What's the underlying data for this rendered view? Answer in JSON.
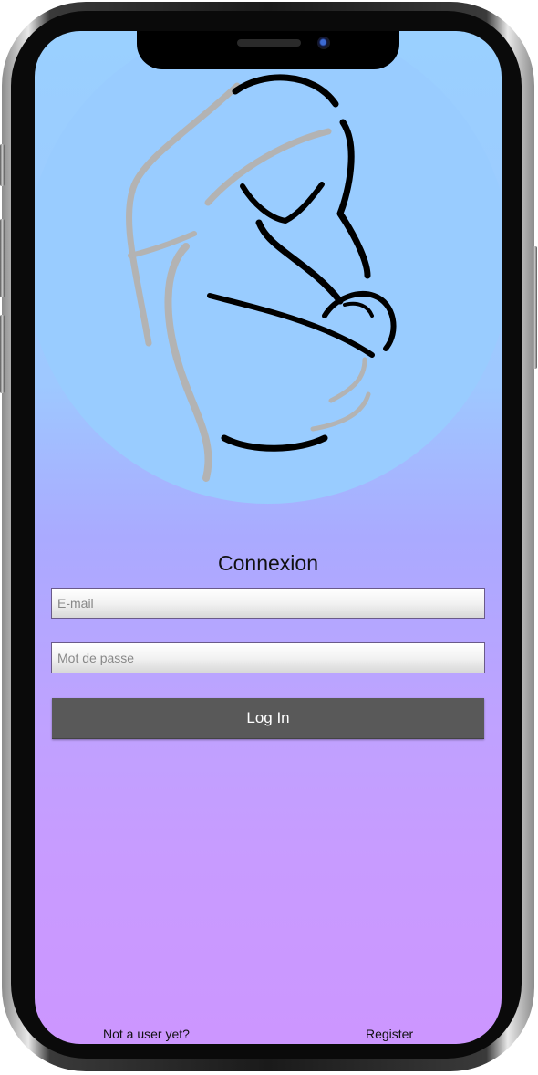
{
  "login": {
    "title": "Connexion",
    "email_placeholder": "E-mail",
    "password_placeholder": "Mot de passe",
    "login_label": "Log In"
  },
  "footer": {
    "prompt": "Not a user yet?",
    "register_label": "Register"
  },
  "colors": {
    "circle": "#99ccff",
    "gradient_top": "#9ad0ff",
    "gradient_bottom": "#cc96ff",
    "button": "#595959"
  },
  "icons": {
    "logo": "pregnant-mother-line-art-logo"
  }
}
